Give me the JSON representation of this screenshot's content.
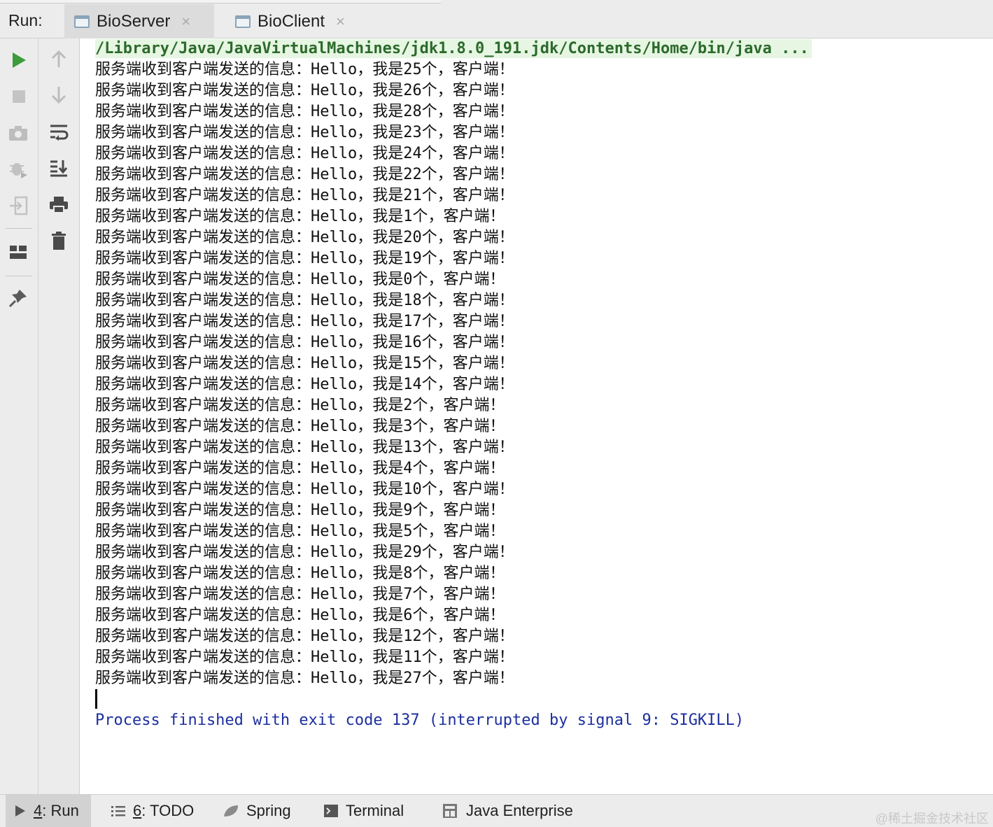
{
  "header": {
    "run_label": "Run:",
    "tabs": [
      {
        "label": "BioServer",
        "close": "×"
      },
      {
        "label": "BioClient",
        "close": "×"
      }
    ]
  },
  "console": {
    "command": "/Library/Java/JavaVirtualMachines/jdk1.8.0_191.jdk/Contents/Home/bin/java ...",
    "lines": [
      "服务端收到客户端发送的信息：Hello，我是25个，客户端！",
      "服务端收到客户端发送的信息：Hello，我是26个，客户端！",
      "服务端收到客户端发送的信息：Hello，我是28个，客户端！",
      "服务端收到客户端发送的信息：Hello，我是23个，客户端！",
      "服务端收到客户端发送的信息：Hello，我是24个，客户端！",
      "服务端收到客户端发送的信息：Hello，我是22个，客户端！",
      "服务端收到客户端发送的信息：Hello，我是21个，客户端！",
      "服务端收到客户端发送的信息：Hello，我是1个，客户端！",
      "服务端收到客户端发送的信息：Hello，我是20个，客户端！",
      "服务端收到客户端发送的信息：Hello，我是19个，客户端！",
      "服务端收到客户端发送的信息：Hello，我是0个，客户端！",
      "服务端收到客户端发送的信息：Hello，我是18个，客户端！",
      "服务端收到客户端发送的信息：Hello，我是17个，客户端！",
      "服务端收到客户端发送的信息：Hello，我是16个，客户端！",
      "服务端收到客户端发送的信息：Hello，我是15个，客户端！",
      "服务端收到客户端发送的信息：Hello，我是14个，客户端！",
      "服务端收到客户端发送的信息：Hello，我是2个，客户端！",
      "服务端收到客户端发送的信息：Hello，我是3个，客户端！",
      "服务端收到客户端发送的信息：Hello，我是13个，客户端！",
      "服务端收到客户端发送的信息：Hello，我是4个，客户端！",
      "服务端收到客户端发送的信息：Hello，我是10个，客户端！",
      "服务端收到客户端发送的信息：Hello，我是9个，客户端！",
      "服务端收到客户端发送的信息：Hello，我是5个，客户端！",
      "服务端收到客户端发送的信息：Hello，我是29个，客户端！",
      "服务端收到客户端发送的信息：Hello，我是8个，客户端！",
      "服务端收到客户端发送的信息：Hello，我是7个，客户端！",
      "服务端收到客户端发送的信息：Hello，我是6个，客户端！",
      "服务端收到客户端发送的信息：Hello，我是12个，客户端！",
      "服务端收到客户端发送的信息：Hello，我是11个，客户端！",
      "服务端收到客户端发送的信息：Hello，我是27个，客户端！"
    ],
    "exit_message": "Process finished with exit code 137 (interrupted by signal 9: SIGKILL)"
  },
  "toolbar_left": [
    "run-icon",
    "stop-icon",
    "camera-icon",
    "debug-icon",
    "exit-icon",
    "layout-icon",
    "pin-icon"
  ],
  "toolbar_right": [
    "up-arrow-icon",
    "down-arrow-icon",
    "soft-wrap-icon",
    "scroll-to-end-icon",
    "print-icon",
    "trash-icon"
  ],
  "bottom_bar": {
    "run": {
      "num": "4",
      "label": ": Run"
    },
    "todo": {
      "num": "6",
      "label": ": TODO"
    },
    "spring": "Spring",
    "terminal": "Terminal",
    "java_enterprise": "Java Enterprise"
  },
  "watermark": "@稀土掘金技术社区",
  "colors": {
    "run_green": "#3c9c3c",
    "command_green": "#2c6a2c",
    "exit_blue": "#1d2f9e",
    "command_bg": "#e6f6e2"
  }
}
